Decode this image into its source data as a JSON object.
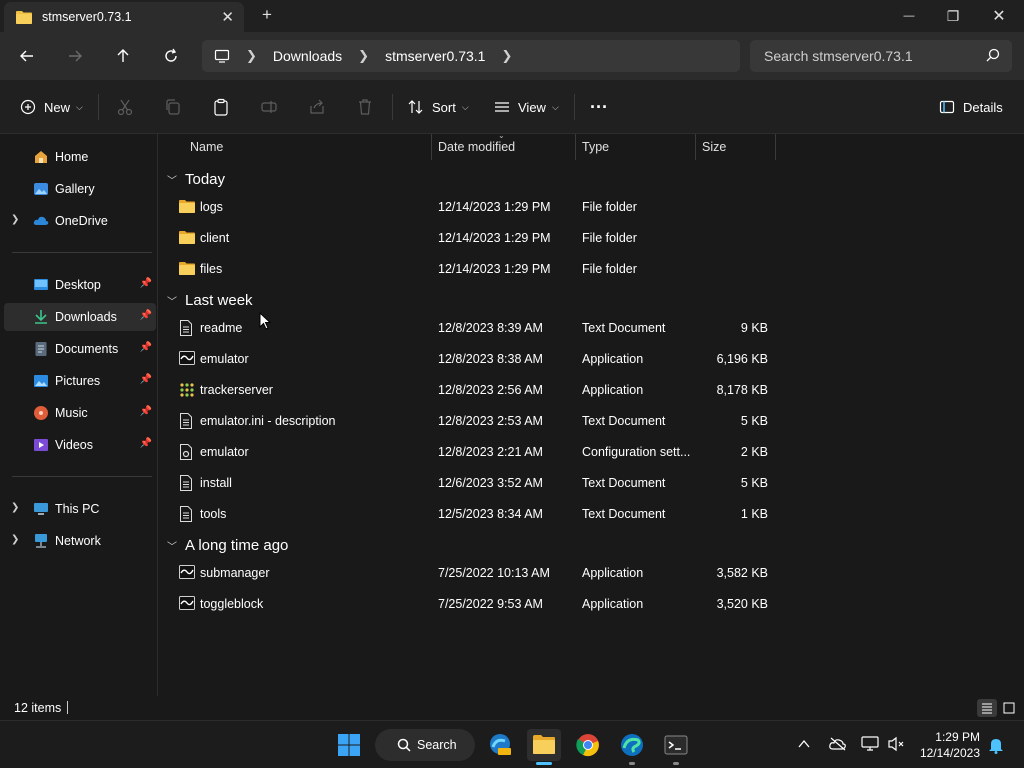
{
  "window": {
    "tab_title": "stmserver0.73.1",
    "new_tab_label": "+",
    "minimize": "—",
    "maximize": "❐",
    "close": "✕"
  },
  "address": {
    "crumbs": [
      "Downloads",
      "stmserver0.73.1"
    ],
    "search_placeholder": "Search stmserver0.73.1"
  },
  "commands": {
    "new_label": "New",
    "sort_label": "Sort",
    "view_label": "View",
    "more_label": "···",
    "details_label": "Details"
  },
  "sidebar": {
    "items": [
      {
        "label": "Home",
        "icon": "home-icon"
      },
      {
        "label": "Gallery",
        "icon": "gallery-icon"
      },
      {
        "label": "OneDrive",
        "icon": "cloud-icon"
      },
      {
        "label": "Desktop",
        "icon": "desktop-icon"
      },
      {
        "label": "Downloads",
        "icon": "download-icon"
      },
      {
        "label": "Documents",
        "icon": "documents-icon"
      },
      {
        "label": "Pictures",
        "icon": "pictures-icon"
      },
      {
        "label": "Music",
        "icon": "music-icon"
      },
      {
        "label": "Videos",
        "icon": "videos-icon"
      },
      {
        "label": "This PC",
        "icon": "pc-icon"
      },
      {
        "label": "Network",
        "icon": "network-icon"
      }
    ]
  },
  "columns": {
    "name": "Name",
    "date": "Date modified",
    "type": "Type",
    "size": "Size"
  },
  "groups": [
    {
      "title": "Today",
      "files": [
        {
          "name": "logs",
          "date": "12/14/2023 1:29 PM",
          "type": "File folder",
          "size": "",
          "icon": "folder-icon"
        },
        {
          "name": "client",
          "date": "12/14/2023 1:29 PM",
          "type": "File folder",
          "size": "",
          "icon": "folder-icon"
        },
        {
          "name": "files",
          "date": "12/14/2023 1:29 PM",
          "type": "File folder",
          "size": "",
          "icon": "folder-icon"
        }
      ]
    },
    {
      "title": "Last week",
      "files": [
        {
          "name": "readme",
          "date": "12/8/2023 8:39 AM",
          "type": "Text Document",
          "size": "9 KB",
          "icon": "text-file-icon"
        },
        {
          "name": "emulator",
          "date": "12/8/2023 8:38 AM",
          "type": "Application",
          "size": "6,196 KB",
          "icon": "app-icon"
        },
        {
          "name": "trackerserver",
          "date": "12/8/2023 2:56 AM",
          "type": "Application",
          "size": "8,178 KB",
          "icon": "grid-app-icon"
        },
        {
          "name": "emulator.ini - description",
          "date": "12/8/2023 2:53 AM",
          "type": "Text Document",
          "size": "5 KB",
          "icon": "text-file-icon"
        },
        {
          "name": "emulator",
          "date": "12/8/2023 2:21 AM",
          "type": "Configuration sett...",
          "size": "2 KB",
          "icon": "config-file-icon"
        },
        {
          "name": "install",
          "date": "12/6/2023 3:52 AM",
          "type": "Text Document",
          "size": "5 KB",
          "icon": "text-file-icon"
        },
        {
          "name": "tools",
          "date": "12/5/2023 8:34 AM",
          "type": "Text Document",
          "size": "1 KB",
          "icon": "text-file-icon"
        }
      ]
    },
    {
      "title": "A long time ago",
      "files": [
        {
          "name": "submanager",
          "date": "7/25/2022 10:13 AM",
          "type": "Application",
          "size": "3,582 KB",
          "icon": "app-icon"
        },
        {
          "name": "toggleblock",
          "date": "7/25/2022 9:53 AM",
          "type": "Application",
          "size": "3,520 KB",
          "icon": "app-icon"
        }
      ]
    }
  ],
  "status": {
    "item_count": "12 items"
  },
  "taskbar": {
    "search_label": "Search",
    "time": "1:29 PM",
    "date": "12/14/2023"
  },
  "colors": {
    "folder": "#f0c043",
    "accent": "#4cc2ff",
    "background": "#191919"
  }
}
